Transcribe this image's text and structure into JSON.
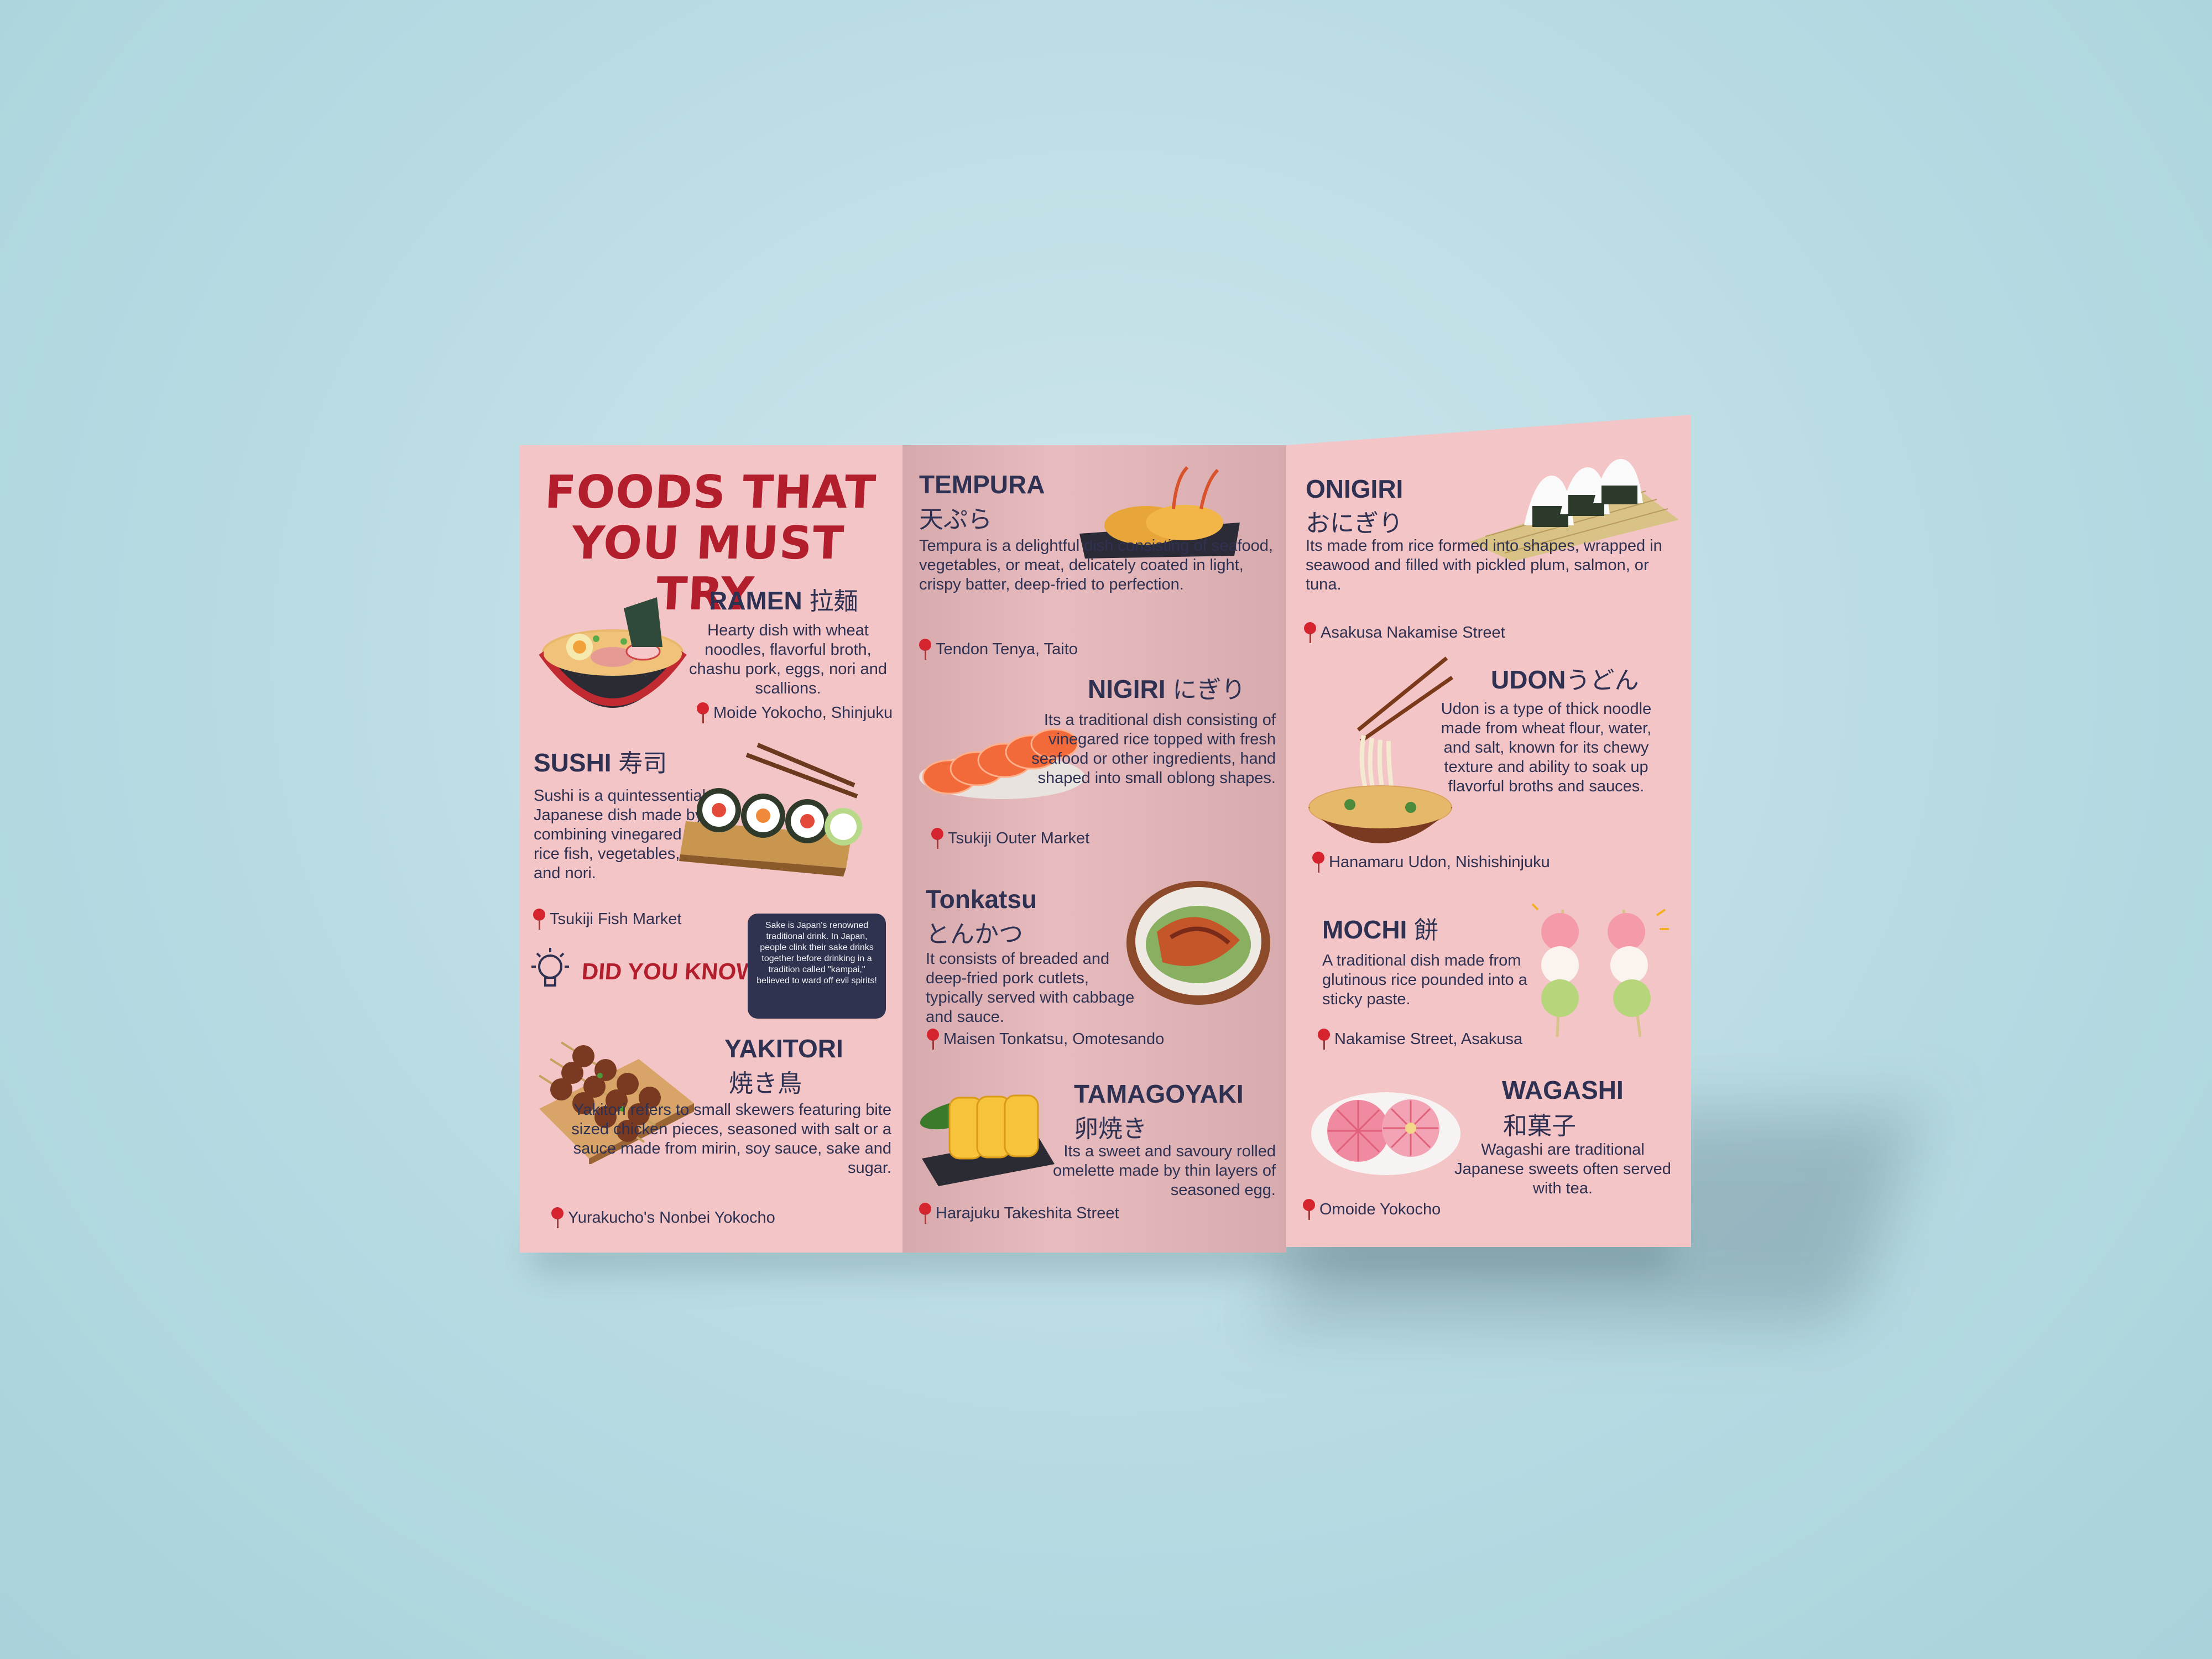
{
  "heading": "FOODS THAT YOU MUST TRY",
  "foods": {
    "ramen": {
      "name": "RAMEN",
      "jp": "拉麺",
      "desc": "Hearty dish with wheat noodles, flavorful broth, chashu pork, eggs, nori and scallions.",
      "loc": "Moide Yokocho, Shinjuku"
    },
    "sushi": {
      "name": "SUSHI",
      "jp": "寿司",
      "desc": "Sushi is a quintessential Japanese dish made by combining vinegared rice fish, vegetables, and nori.",
      "loc": "Tsukiji Fish Market"
    },
    "yakitori": {
      "name": "YAKITORI",
      "jp": "焼き鳥",
      "desc": "Yakitori refers to small skewers featuring bite sized chicken pieces, seasoned with salt or a sauce made from mirin, soy sauce, sake and sugar.",
      "loc": "Yurakucho's Nonbei Yokocho"
    },
    "tempura": {
      "name": "TEMPURA",
      "jp": "天ぷら",
      "desc": "Tempura is a delightful dish consisting of seafood, vegetables, or meat, delicately coated in light, crispy batter, deep-fried to perfection.",
      "loc": "Tendon Tenya, Taito"
    },
    "nigiri": {
      "name": "NIGIRI",
      "jp": "にぎり",
      "desc": "Its a traditional dish consisting of vinegared rice topped with fresh seafood or other ingredients, hand shaped into small oblong shapes.",
      "loc": "Tsukiji Outer Market"
    },
    "tonkatsu": {
      "name": "Tonkatsu",
      "jp": "とんかつ",
      "desc": "It consists of breaded and deep-fried pork cutlets, typically served with cabbage and sauce.",
      "loc": "Maisen Tonkatsu, Omotesando"
    },
    "tamagoyaki": {
      "name": "TAMAGOYAKI",
      "jp": "卵焼き",
      "desc": "Its a sweet and savoury rolled omelette made by thin layers of seasoned egg.",
      "loc": "Harajuku Takeshita Street"
    },
    "onigiri": {
      "name": "ONIGIRI",
      "jp": "おにぎり",
      "desc": "Its made from rice formed into shapes, wrapped in seawood and filled with pickled plum, salmon, or tuna.",
      "loc": "Asakusa Nakamise Street"
    },
    "udon": {
      "name": "UDON",
      "jp": "うどん",
      "desc": "Udon is a type of thick noodle made from wheat flour, water, and salt, known for its chewy texture and ability to soak up flavorful broths and sauces.",
      "loc": "Hanamaru Udon, Nishishinjuku"
    },
    "mochi": {
      "name": "MOCHI",
      "jp": "餅",
      "desc": "A traditional dish made from glutinous rice pounded into a sticky paste.",
      "loc": "Nakamise Street, Asakusa"
    },
    "wagashi": {
      "name": "WAGASHI",
      "jp": "和菓子",
      "desc": "Wagashi are traditional Japanese sweets often served with tea.",
      "loc": "Omoide Yokocho"
    }
  },
  "did_you_know": {
    "label": "DID YOU KNOW?",
    "fact": "Sake is Japan's renowned traditional drink. In Japan, people clink their sake drinks together before drinking in a tradition called \"kampai,\" believed to ward off evil spirits!"
  },
  "icons": [
    "location-pin-icon",
    "lightbulb-icon"
  ],
  "colors": {
    "panel": "#f3c5c6",
    "title": "#b21e2c",
    "text": "#2e3152",
    "pin": "#d6242e",
    "factbox": "#2f3350",
    "background": "#b8dbe3"
  }
}
